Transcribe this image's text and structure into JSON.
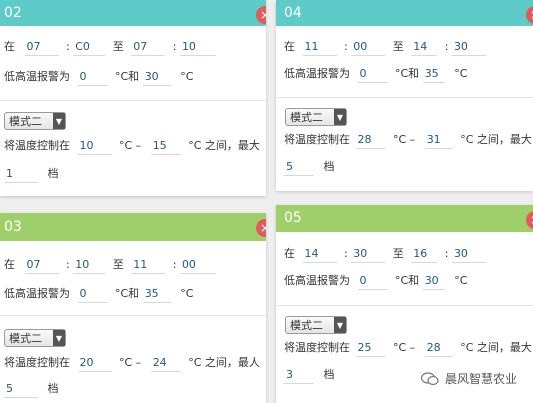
{
  "cards": {
    "c02": {
      "title": "02",
      "start_h": "07",
      "start_m": "C0",
      "end_h": "07",
      "end_m": "10",
      "alarm_low": "0",
      "alarm_high": "30",
      "mode": "模式二",
      "temp_low": "10",
      "temp_high": "15",
      "gear": "1"
    },
    "c03": {
      "title": "03",
      "start_h": "07",
      "start_m": "10",
      "end_h": "11",
      "end_m": "00",
      "alarm_low": "0",
      "alarm_high": "35",
      "mode": "模式二",
      "temp_low": "20",
      "temp_high": "24",
      "gear": "5"
    },
    "c04": {
      "title": "04",
      "start_h": "11",
      "start_m": "00",
      "end_h": "14",
      "end_m": "30",
      "alarm_low": "0",
      "alarm_high": "35",
      "mode": "模式二",
      "temp_low": "28",
      "temp_high": "31",
      "gear": "5"
    },
    "c05": {
      "title": "05",
      "start_h": "14",
      "start_m": "30",
      "end_h": "16",
      "end_m": "30",
      "alarm_low": "0",
      "alarm_high": "30",
      "mode": "模式二",
      "temp_low": "25",
      "temp_high": "28",
      "gear": "3"
    }
  },
  "labels": {
    "at": "在",
    "colon": ":",
    "to": "至",
    "alarm_prefix": "低高温报警为",
    "celsius_and": "°C和",
    "celsius": "°C",
    "control_prefix": "将温度控制在",
    "celsius_dash": "°C –",
    "between_max": "°C 之间，最大",
    "between_max_alt": "°C 之间，最人",
    "gear_unit": "档",
    "close": "×",
    "arrow": "▼"
  },
  "watermark": "晨风智慧农业",
  "colors": {
    "teal": "#5fcbc8",
    "green": "#9fcf6a",
    "close": "#e05b5b"
  }
}
